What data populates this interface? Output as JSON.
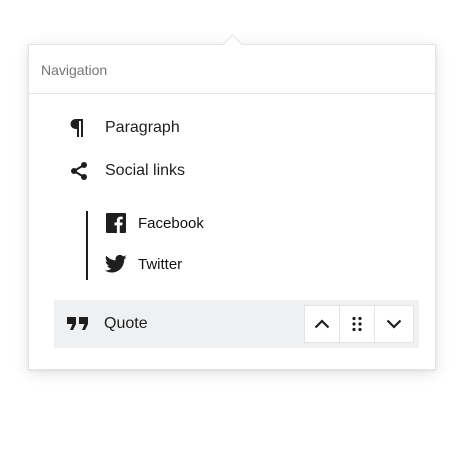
{
  "header": {
    "title": "Navigation"
  },
  "items": [
    {
      "label": "Paragraph",
      "icon": "paragraph-icon"
    },
    {
      "label": "Social links",
      "icon": "share-icon"
    },
    {
      "label": "Facebook",
      "icon": "facebook-icon"
    },
    {
      "label": "Twitter",
      "icon": "twitter-icon"
    },
    {
      "label": "Quote",
      "icon": "quote-icon",
      "selected": true
    }
  ],
  "movers": [
    "chevron-up-icon",
    "drag-handle-icon",
    "chevron-down-icon"
  ]
}
